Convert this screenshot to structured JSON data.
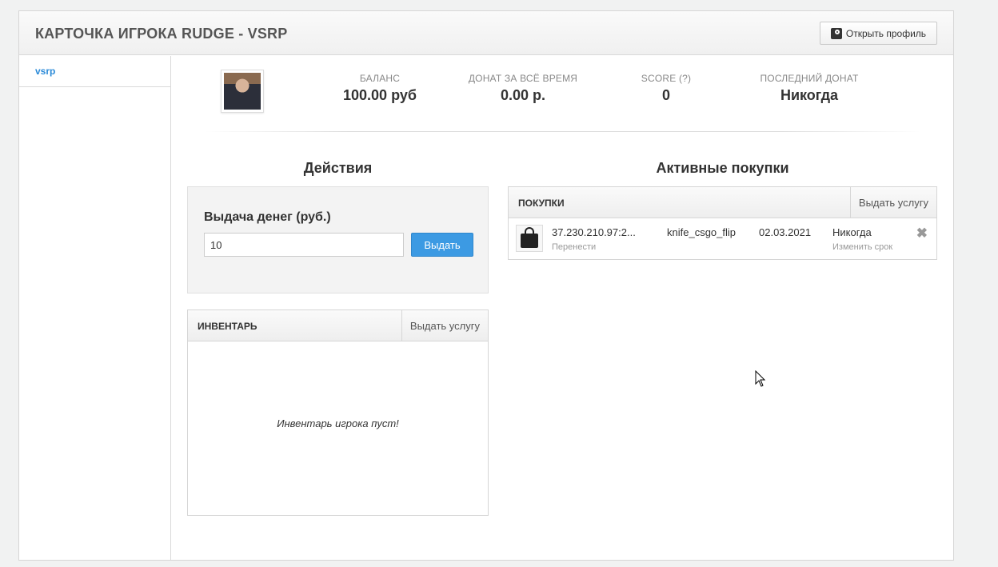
{
  "header": {
    "title": "КАРТОЧКА ИГРОКА RUDGE - VSRP",
    "open_profile_label": "Открыть профиль"
  },
  "sidebar": {
    "items": [
      {
        "label": "vsrp"
      }
    ]
  },
  "stats": [
    {
      "label": "БАЛАНС",
      "value": "100.00 руб"
    },
    {
      "label": "ДОНАТ ЗА ВСЁ ВРЕМЯ",
      "value": "0.00 р."
    },
    {
      "label": "SCORE (?)",
      "value": "0"
    },
    {
      "label": "ПОСЛЕДНИЙ ДОНАТ",
      "value": "Никогда"
    }
  ],
  "actions": {
    "title": "Действия",
    "money": {
      "title": "Выдача денег (руб.)",
      "input_value": "10",
      "button_label": "Выдать"
    }
  },
  "inventory": {
    "title": "ИНВЕНТАРЬ",
    "add_label": "Выдать услугу",
    "empty_text": "Инвентарь игрока пуст!"
  },
  "purchases": {
    "section_title": "Активные покупки",
    "title": "ПОКУПКИ",
    "add_label": "Выдать услугу",
    "rows": [
      {
        "server": "37.230.210.97:2...",
        "move_label": "Перенести",
        "item": "knife_csgo_flip",
        "date": "02.03.2021",
        "expires": "Никогда",
        "change_label": "Изменить срок",
        "remove_icon": "close-icon"
      }
    ]
  }
}
